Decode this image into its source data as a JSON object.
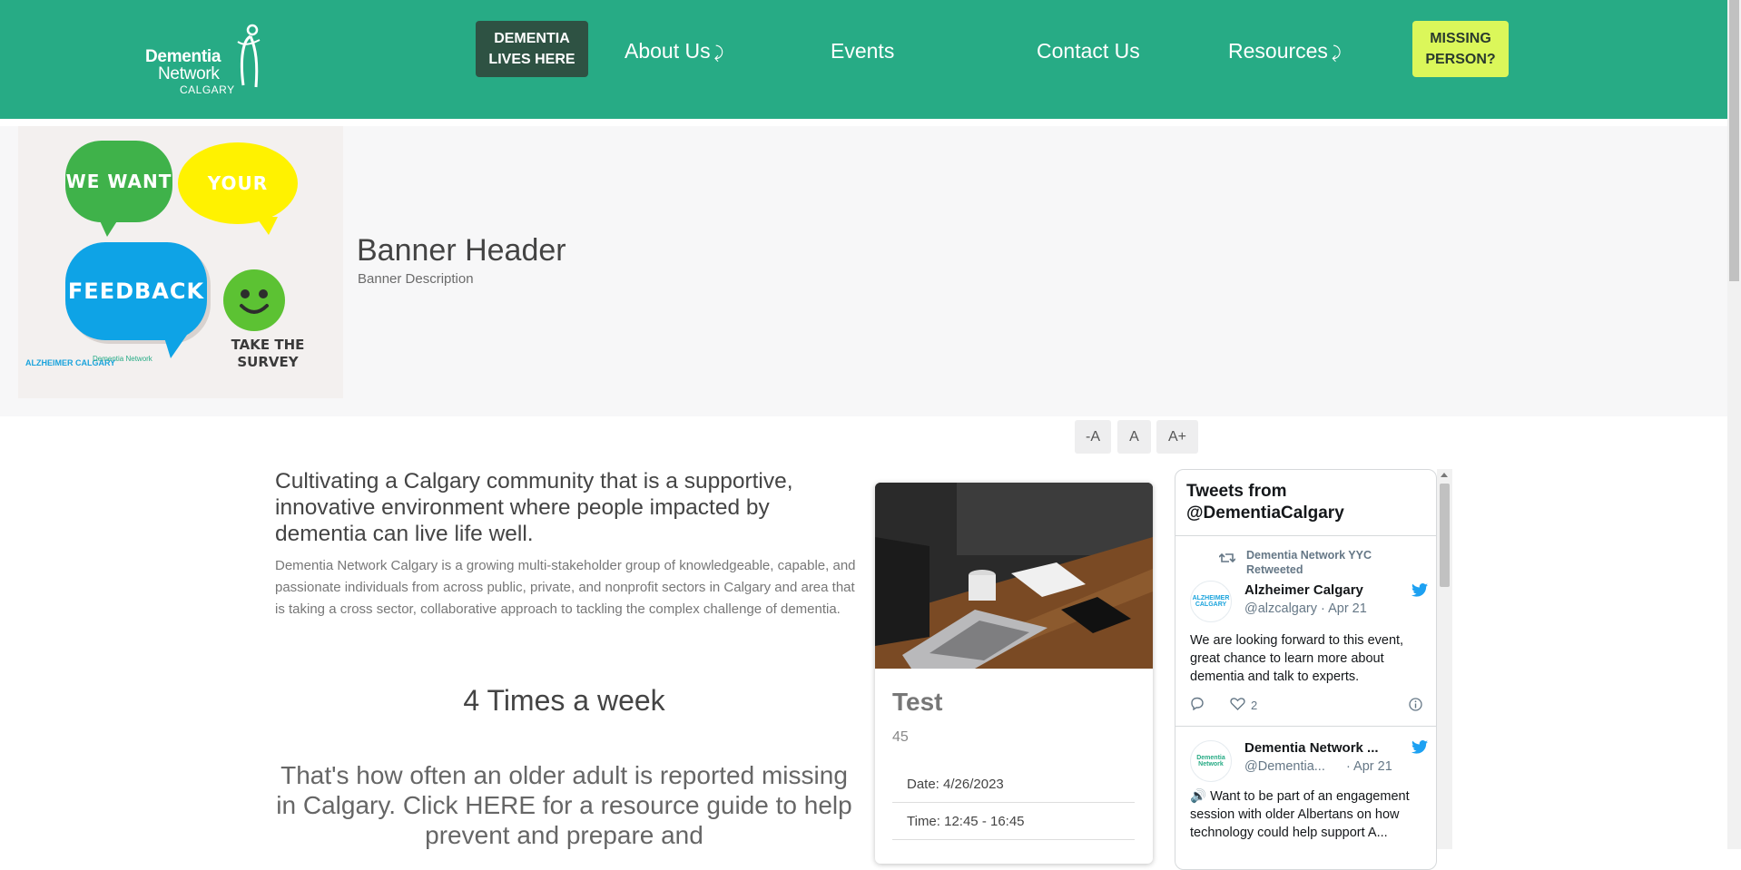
{
  "header": {
    "logo": {
      "line1": "Dementia",
      "line2": "Network",
      "line3": "CALGARY"
    },
    "dementia_lives_here": "DEMENTIA\nLIVES HERE",
    "nav": [
      {
        "label": "About Us",
        "caret": "⤸"
      },
      {
        "label": "Events"
      },
      {
        "label": "Contact Us"
      },
      {
        "label": "Resources",
        "caret": "⤸"
      }
    ],
    "missing_person": "MISSING\nPERSON?"
  },
  "banner": {
    "image": {
      "bubble1": "WE WANT",
      "bubble2": "YOUR",
      "bubble3": "FEEDBACK",
      "cta": "TAKE THE\nSURVEY",
      "alz_logo": "ALZHEIMER CALGARY",
      "dnc_logo": "Dementia Network"
    },
    "title": "Banner Header",
    "description": "Banner Description"
  },
  "font_controls": {
    "decrease": "-A",
    "reset": "A",
    "increase": "A+"
  },
  "main": {
    "lead": "Cultivating a Calgary community that is a supportive, innovative environment where people impacted by dementia can live life well.",
    "body": "Dementia Network Calgary is a growing multi-stakeholder group of knowledgeable, capable, and passionate individuals from across public, private, and nonprofit sectors in Calgary and area that is taking a cross sector, collaborative approach to tackling the complex challenge of dementia.",
    "stat_heading": "4 Times a week",
    "stat_text": "That's how often an older adult is reported missing in Calgary. Click HERE for a resource guide to help prevent and prepare and"
  },
  "event_card": {
    "title": "Test",
    "subtitle": "45",
    "date": "Date: 4/26/2023",
    "time": "Time: 12:45 - 16:45"
  },
  "twitter": {
    "heading": "Tweets from\n@DementiaCalgary",
    "tweets": [
      {
        "retweeted_by": "Dementia Network YYC\nRetweeted",
        "name": "Alzheimer Calgary",
        "handle": "@alzcalgary · Apr 21",
        "text": "We are looking forward to this event, great chance to learn more about dementia and talk to experts.",
        "likes": "2"
      },
      {
        "name": "Dementia Network ...",
        "handle": "@Dementia...",
        "date": "· Apr 21",
        "text": "🔊 Want to be part of an engagement session with older Albertans on how technology could help support A..."
      }
    ]
  },
  "colors": {
    "header_bg": "#27ab85",
    "dlh_button": "#2e5243",
    "missing_button": "#dbf75a",
    "banner_bg": "#f7f7f8"
  }
}
